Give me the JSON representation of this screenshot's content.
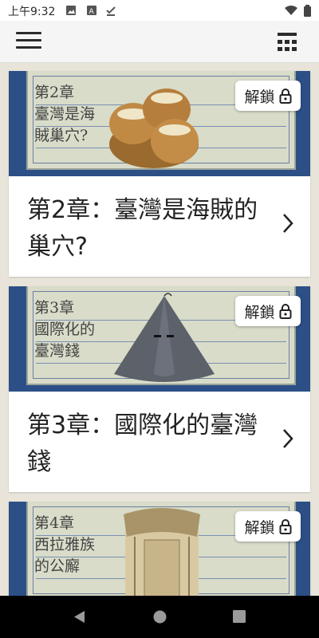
{
  "status_bar": {
    "time": "上午9:32"
  },
  "app_bar": {
    "menu_icon": "hamburger-menu-icon",
    "right_icon": "calculator-icon"
  },
  "chapters": [
    {
      "handwriting": [
        "第2章",
        "臺灣是海",
        "賊巢穴?"
      ],
      "unlock_label": "解鎖",
      "title": "第2章：臺灣是海賊的巢穴?",
      "illustration": "sacks-of-rice"
    },
    {
      "handwriting": [
        "第3章",
        "國際化的",
        "臺灣錢"
      ],
      "unlock_label": "解鎖",
      "title": "第3章：國際化的臺灣錢",
      "illustration": "cone-bag"
    },
    {
      "handwriting": [
        "第4章",
        "西拉雅族",
        "的公廨"
      ],
      "unlock_label": "解鎖",
      "title": "",
      "illustration": "thatched-hut"
    }
  ],
  "colors": {
    "art_bg": "#2c4f86",
    "paper": "#d8dcc9"
  }
}
